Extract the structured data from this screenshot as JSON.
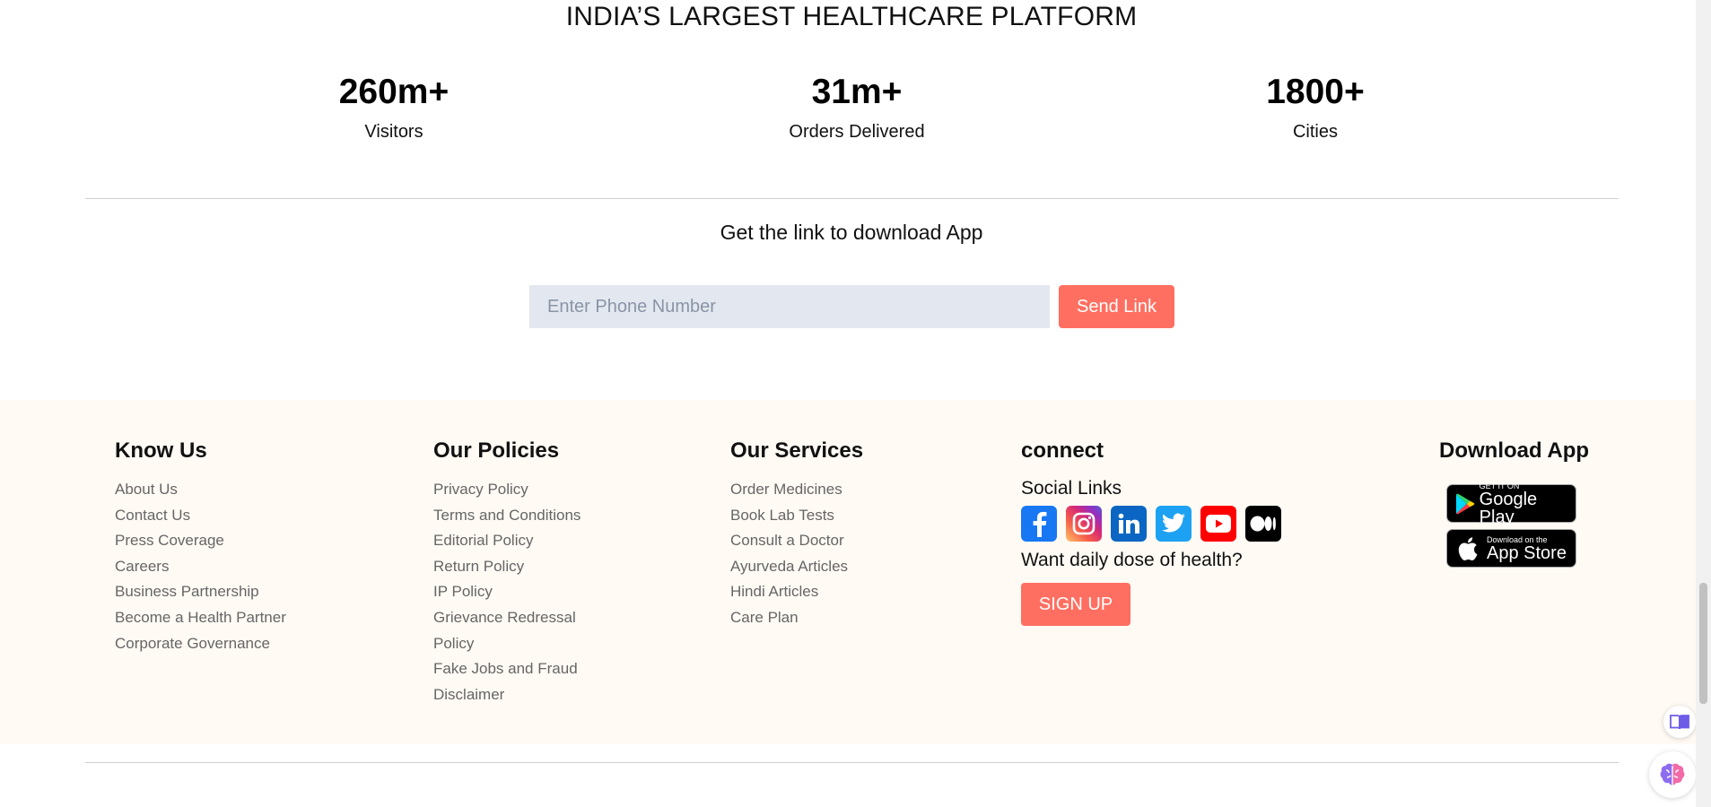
{
  "hero": {
    "title": "INDIA’S LARGEST HEALTHCARE PLATFORM",
    "stats": [
      {
        "number": "260m+",
        "label": "Visitors"
      },
      {
        "number": "31m+",
        "label": "Orders Delivered"
      },
      {
        "number": "1800+",
        "label": "Cities"
      }
    ]
  },
  "download": {
    "title": "Get the link to download App",
    "phone_placeholder": "Enter Phone Number",
    "send_label": "Send Link"
  },
  "footer": {
    "know_us": {
      "heading": "Know Us",
      "links": [
        "About Us",
        "Contact Us",
        "Press Coverage",
        "Careers",
        "Business Partnership",
        "Become a Health Partner",
        "Corporate Governance"
      ]
    },
    "policies": {
      "heading": "Our Policies",
      "links": [
        "Privacy Policy",
        "Terms and Conditions",
        "Editorial Policy",
        "Return Policy",
        "IP Policy",
        "Grievance Redressal",
        "Policy",
        "Fake Jobs and Fraud",
        "Disclaimer"
      ]
    },
    "services": {
      "heading": "Our Services",
      "links": [
        "Order Medicines",
        "Book Lab Tests",
        "Consult a Doctor",
        "Ayurveda Articles",
        "Hindi Articles",
        "Care Plan"
      ]
    },
    "connect": {
      "heading": "connect",
      "social_label": "Social Links",
      "social_icons": [
        "facebook-icon",
        "instagram-icon",
        "linkedin-icon",
        "twitter-icon",
        "youtube-icon",
        "medium-icon"
      ],
      "daily_text": "Want daily dose of health?",
      "signup_label": "SIGN UP"
    },
    "app": {
      "heading": "Download App",
      "google_small": "GET IT ON",
      "google_big": "Google Play",
      "apple_small": "Download on the",
      "apple_big": "App Store"
    }
  },
  "colors": {
    "accent": "#ff6f61",
    "footer_bg": "#fffaf4",
    "input_bg": "#e3e8f0"
  }
}
